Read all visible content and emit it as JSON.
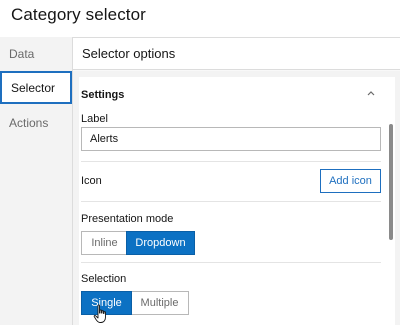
{
  "header": {
    "title": "Category selector"
  },
  "nav": {
    "items": [
      {
        "label": "Data"
      },
      {
        "label": "Selector"
      },
      {
        "label": "Actions"
      }
    ]
  },
  "panel": {
    "title": "Selector options",
    "section_title": "Settings",
    "label_field": {
      "label": "Label",
      "value": "Alerts"
    },
    "icon_field": {
      "label": "Icon",
      "button": "Add icon"
    },
    "presentation_mode": {
      "label": "Presentation mode",
      "options": [
        "Inline",
        "Dropdown"
      ],
      "selected": "Dropdown"
    },
    "selection": {
      "label": "Selection",
      "options": [
        "Single",
        "Multiple"
      ],
      "selected": "Single"
    }
  },
  "colors": {
    "accent": "#0c71c3",
    "nav_bg": "#f3f3f3"
  },
  "icons": {
    "collapse": "chevron-up-icon",
    "cursor": "hand-pointer-icon"
  }
}
